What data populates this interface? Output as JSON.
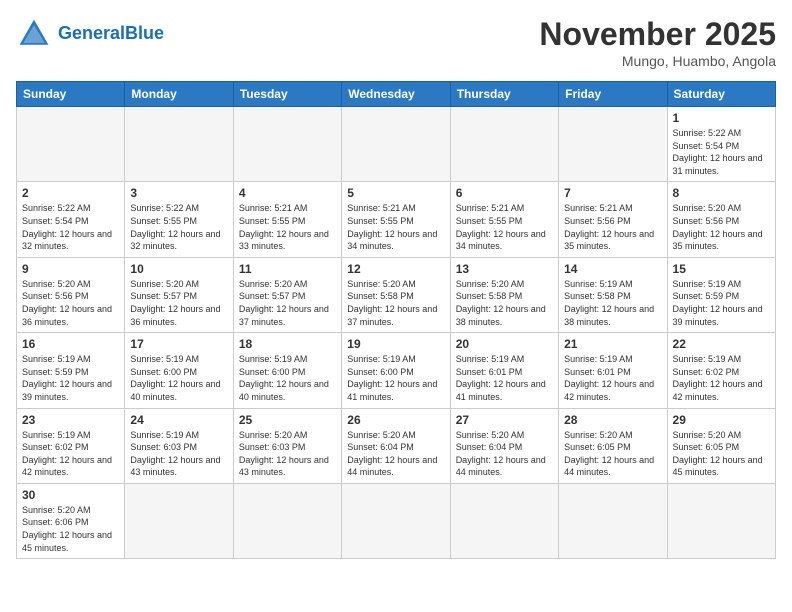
{
  "header": {
    "logo_general": "General",
    "logo_blue": "Blue",
    "month_title": "November 2025",
    "subtitle": "Mungo, Huambo, Angola"
  },
  "days_of_week": [
    "Sunday",
    "Monday",
    "Tuesday",
    "Wednesday",
    "Thursday",
    "Friday",
    "Saturday"
  ],
  "weeks": [
    [
      {
        "day": "",
        "info": ""
      },
      {
        "day": "",
        "info": ""
      },
      {
        "day": "",
        "info": ""
      },
      {
        "day": "",
        "info": ""
      },
      {
        "day": "",
        "info": ""
      },
      {
        "day": "",
        "info": ""
      },
      {
        "day": "1",
        "info": "Sunrise: 5:22 AM\nSunset: 5:54 PM\nDaylight: 12 hours and 31 minutes."
      }
    ],
    [
      {
        "day": "2",
        "info": "Sunrise: 5:22 AM\nSunset: 5:54 PM\nDaylight: 12 hours and 32 minutes."
      },
      {
        "day": "3",
        "info": "Sunrise: 5:22 AM\nSunset: 5:55 PM\nDaylight: 12 hours and 32 minutes."
      },
      {
        "day": "4",
        "info": "Sunrise: 5:21 AM\nSunset: 5:55 PM\nDaylight: 12 hours and 33 minutes."
      },
      {
        "day": "5",
        "info": "Sunrise: 5:21 AM\nSunset: 5:55 PM\nDaylight: 12 hours and 34 minutes."
      },
      {
        "day": "6",
        "info": "Sunrise: 5:21 AM\nSunset: 5:55 PM\nDaylight: 12 hours and 34 minutes."
      },
      {
        "day": "7",
        "info": "Sunrise: 5:21 AM\nSunset: 5:56 PM\nDaylight: 12 hours and 35 minutes."
      },
      {
        "day": "8",
        "info": "Sunrise: 5:20 AM\nSunset: 5:56 PM\nDaylight: 12 hours and 35 minutes."
      }
    ],
    [
      {
        "day": "9",
        "info": "Sunrise: 5:20 AM\nSunset: 5:56 PM\nDaylight: 12 hours and 36 minutes."
      },
      {
        "day": "10",
        "info": "Sunrise: 5:20 AM\nSunset: 5:57 PM\nDaylight: 12 hours and 36 minutes."
      },
      {
        "day": "11",
        "info": "Sunrise: 5:20 AM\nSunset: 5:57 PM\nDaylight: 12 hours and 37 minutes."
      },
      {
        "day": "12",
        "info": "Sunrise: 5:20 AM\nSunset: 5:58 PM\nDaylight: 12 hours and 37 minutes."
      },
      {
        "day": "13",
        "info": "Sunrise: 5:20 AM\nSunset: 5:58 PM\nDaylight: 12 hours and 38 minutes."
      },
      {
        "day": "14",
        "info": "Sunrise: 5:19 AM\nSunset: 5:58 PM\nDaylight: 12 hours and 38 minutes."
      },
      {
        "day": "15",
        "info": "Sunrise: 5:19 AM\nSunset: 5:59 PM\nDaylight: 12 hours and 39 minutes."
      }
    ],
    [
      {
        "day": "16",
        "info": "Sunrise: 5:19 AM\nSunset: 5:59 PM\nDaylight: 12 hours and 39 minutes."
      },
      {
        "day": "17",
        "info": "Sunrise: 5:19 AM\nSunset: 6:00 PM\nDaylight: 12 hours and 40 minutes."
      },
      {
        "day": "18",
        "info": "Sunrise: 5:19 AM\nSunset: 6:00 PM\nDaylight: 12 hours and 40 minutes."
      },
      {
        "day": "19",
        "info": "Sunrise: 5:19 AM\nSunset: 6:00 PM\nDaylight: 12 hours and 41 minutes."
      },
      {
        "day": "20",
        "info": "Sunrise: 5:19 AM\nSunset: 6:01 PM\nDaylight: 12 hours and 41 minutes."
      },
      {
        "day": "21",
        "info": "Sunrise: 5:19 AM\nSunset: 6:01 PM\nDaylight: 12 hours and 42 minutes."
      },
      {
        "day": "22",
        "info": "Sunrise: 5:19 AM\nSunset: 6:02 PM\nDaylight: 12 hours and 42 minutes."
      }
    ],
    [
      {
        "day": "23",
        "info": "Sunrise: 5:19 AM\nSunset: 6:02 PM\nDaylight: 12 hours and 42 minutes."
      },
      {
        "day": "24",
        "info": "Sunrise: 5:19 AM\nSunset: 6:03 PM\nDaylight: 12 hours and 43 minutes."
      },
      {
        "day": "25",
        "info": "Sunrise: 5:20 AM\nSunset: 6:03 PM\nDaylight: 12 hours and 43 minutes."
      },
      {
        "day": "26",
        "info": "Sunrise: 5:20 AM\nSunset: 6:04 PM\nDaylight: 12 hours and 44 minutes."
      },
      {
        "day": "27",
        "info": "Sunrise: 5:20 AM\nSunset: 6:04 PM\nDaylight: 12 hours and 44 minutes."
      },
      {
        "day": "28",
        "info": "Sunrise: 5:20 AM\nSunset: 6:05 PM\nDaylight: 12 hours and 44 minutes."
      },
      {
        "day": "29",
        "info": "Sunrise: 5:20 AM\nSunset: 6:05 PM\nDaylight: 12 hours and 45 minutes."
      }
    ],
    [
      {
        "day": "30",
        "info": "Sunrise: 5:20 AM\nSunset: 6:06 PM\nDaylight: 12 hours and 45 minutes."
      },
      {
        "day": "",
        "info": ""
      },
      {
        "day": "",
        "info": ""
      },
      {
        "day": "",
        "info": ""
      },
      {
        "day": "",
        "info": ""
      },
      {
        "day": "",
        "info": ""
      },
      {
        "day": "",
        "info": ""
      }
    ]
  ]
}
